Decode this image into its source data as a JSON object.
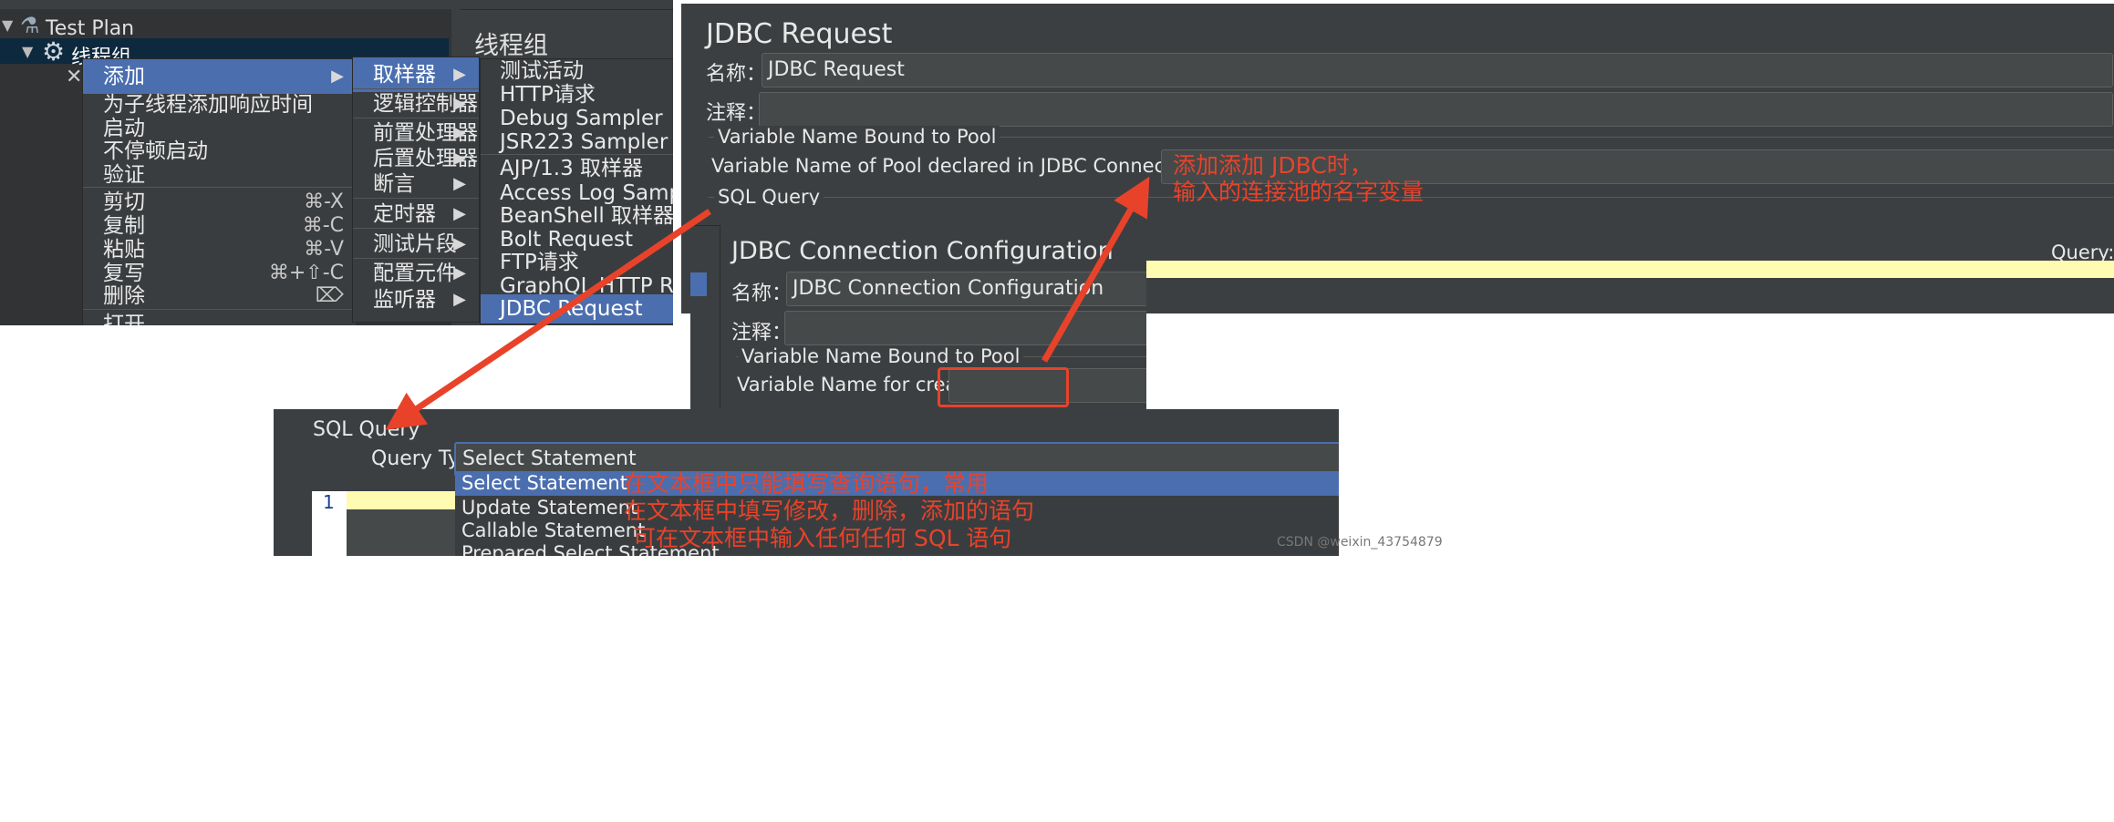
{
  "tree": {
    "test_plan": "Test Plan",
    "thread_group": "线程组",
    "panel_title": "线程组"
  },
  "context_menu": {
    "add": "添加",
    "items": [
      "为子线程添加响应时间",
      "启动",
      "不停顿启动",
      "验证"
    ],
    "edit_items": [
      {
        "label": "剪切",
        "shortcut": "⌘-X"
      },
      {
        "label": "复制",
        "shortcut": "⌘-C"
      },
      {
        "label": "粘贴",
        "shortcut": "⌘-V"
      },
      {
        "label": "复写",
        "shortcut": "⌘+⇧-C"
      },
      {
        "label": "删除",
        "shortcut": "⌦"
      }
    ],
    "open": "打开..."
  },
  "add_submenu": [
    "取样器",
    "逻辑控制器",
    "前置处理器",
    "后置处理器",
    "断言",
    "定时器",
    "测试片段",
    "配置元件",
    "监听器"
  ],
  "sampler_submenu": [
    "测试活动",
    "HTTP请求",
    "Debug Sampler",
    "JSR223 Sampler",
    "AJP/1.3 取样器",
    "Access Log Sampler",
    "BeanShell 取样器",
    "Bolt Request",
    "FTP请求",
    "GraphQL HTTP Request",
    "JDBC Request"
  ],
  "jdbc_request": {
    "title": "JDBC Request",
    "name_label": "名称：",
    "name_value": "JDBC Request",
    "comment_label": "注释：",
    "var_group": "Variable Name Bound to Pool",
    "pool_label": "Variable Name of Pool declared in JDBC Connection Configuration:",
    "sql_group": "SQL Query",
    "query_label": "Query:"
  },
  "jdbc_config": {
    "title": "JDBC Connection Configuration",
    "name_label": "名称：",
    "name_value": "JDBC Connection Configuration",
    "comment_label": "注释：",
    "var_group": "Variable Name Bound to Pool",
    "pool_label": "Variable Name for created pool:"
  },
  "sql_panel": {
    "group": "SQL Query",
    "query_type_label": "Query Type:",
    "query_type_value": "Select Statement",
    "options": [
      "Select Statement",
      "Update Statement",
      "Callable Statement",
      "Prepared Select Statement"
    ],
    "line_number": "1"
  },
  "annotations": {
    "pool_note_1": "添加添加 JDBC时，",
    "pool_note_2": "输入的连接池的名字变量",
    "select_note": "在文本框中只能填写查询语句，常用",
    "update_note": "在文本框中填写修改，删除，添加的语句",
    "callable_note": "可在文本框中输入任何任何 SQL 语句"
  },
  "watermark": "CSDN @weixin_43754879",
  "colors": {
    "panel_bg": "#3c3f41",
    "selected": "#4b6eaf",
    "annotation": "#e8432a",
    "editor_highlight": "#fffbb0"
  }
}
